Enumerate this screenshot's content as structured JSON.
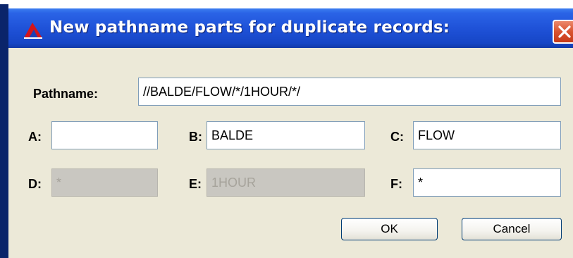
{
  "window": {
    "title": "New pathname parts for duplicate records:"
  },
  "form": {
    "pathname_label": "Pathname:",
    "pathname_value": "//BALDE/FLOW/*/1HOUR/*/",
    "parts": [
      {
        "label": "A:",
        "value": "",
        "enabled": true
      },
      {
        "label": "B:",
        "value": "BALDE",
        "enabled": true
      },
      {
        "label": "C:",
        "value": "FLOW",
        "enabled": true
      },
      {
        "label": "D:",
        "value": "*",
        "enabled": false
      },
      {
        "label": "E:",
        "value": "1HOUR",
        "enabled": false
      },
      {
        "label": "F:",
        "value": "*",
        "enabled": true
      }
    ]
  },
  "buttons": {
    "ok": "OK",
    "cancel": "Cancel"
  },
  "colors": {
    "titlebar": "#1f52d8",
    "dialog_background": "#ece9d8",
    "close_button": "#d9532f",
    "disabled_field": "#c9c7c1"
  },
  "icons": {
    "app": "dss-triangle-icon",
    "close": "close-icon"
  }
}
